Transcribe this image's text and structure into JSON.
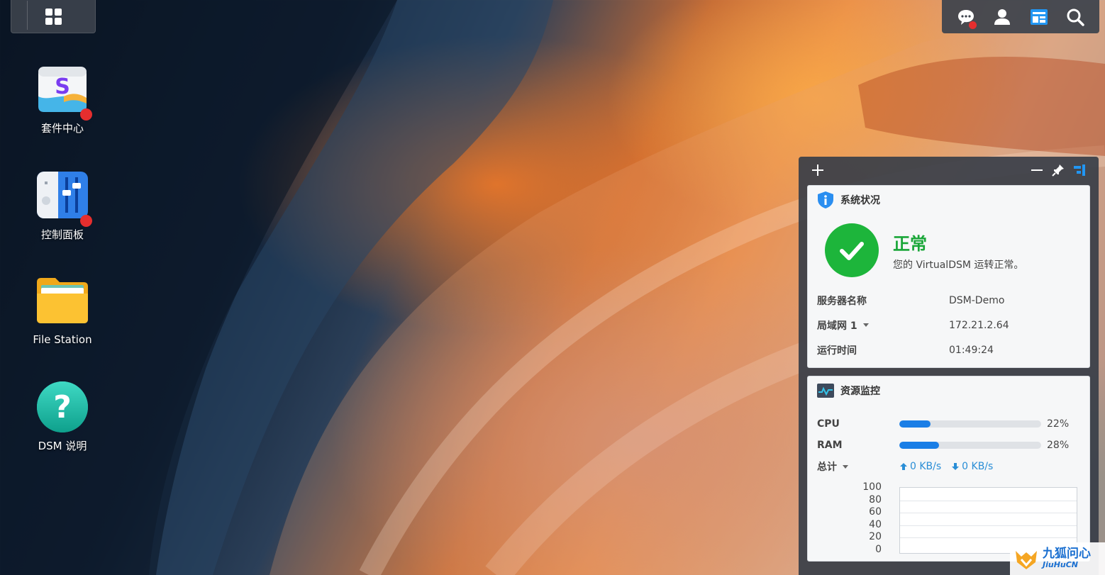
{
  "taskbar": {
    "main_menu": "main-menu",
    "tray": [
      "notification",
      "user",
      "widgets",
      "search"
    ]
  },
  "desktop": {
    "icons": [
      {
        "label": "套件中心",
        "icon": "package-center-icon"
      },
      {
        "label": "控制面板",
        "icon": "control-panel-icon"
      },
      {
        "label": "File Station",
        "icon": "folder-icon"
      },
      {
        "label": "DSM 说明",
        "icon": "help-icon"
      }
    ]
  },
  "system_status": {
    "title": "系统状况",
    "status": "正常",
    "description": "您的 VirtualDSM 运转正常。",
    "rows": [
      {
        "key": "服务器名称",
        "value": "DSM-Demo"
      },
      {
        "key": "局域网 1",
        "value": "172.21.2.64"
      },
      {
        "key": "运行时间",
        "value": "01:49:24"
      }
    ]
  },
  "resource_monitor": {
    "title": "资源监控",
    "cpu_label": "CPU",
    "cpu_percent": 22,
    "cpu_text": "22%",
    "ram_label": "RAM",
    "ram_percent": 28,
    "ram_text": "28%",
    "total_label": "总计",
    "upload": "0 KB/s",
    "download": "0 KB/s",
    "y_ticks": [
      "100",
      "80",
      "60",
      "40",
      "20",
      "0"
    ]
  },
  "colors": {
    "ok_green": "#1db53b",
    "accent_blue": "#1a7ee6",
    "badge_red": "#e62e2e"
  },
  "watermark": {
    "text": "九狐问心",
    "sub": "JiuHuCN"
  }
}
